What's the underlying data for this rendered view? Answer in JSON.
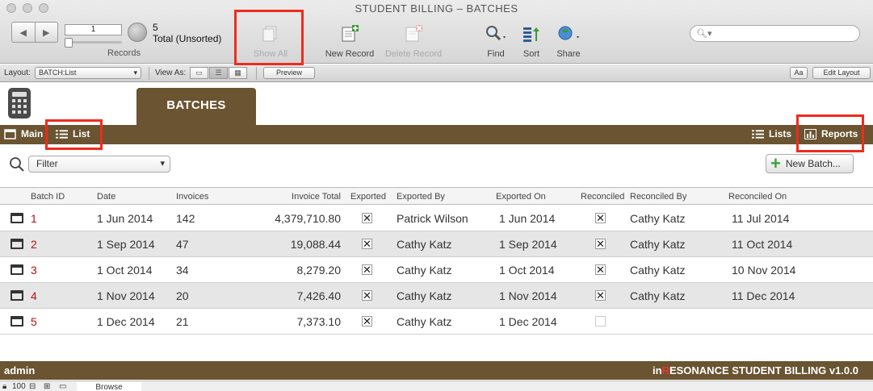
{
  "window": {
    "title": "STUDENT BILLING – BATCHES"
  },
  "toolbar": {
    "record_current": "1",
    "record_count": "5",
    "record_status": "Total (Unsorted)",
    "records_label": "Records",
    "show_all": "Show All",
    "new_record": "New Record",
    "delete_record": "Delete Record",
    "find": "Find",
    "sort": "Sort",
    "share": "Share",
    "search_placeholder": ""
  },
  "layoutbar": {
    "layout_label": "Layout:",
    "layout_value": "BATCH:List",
    "view_as_label": "View As:",
    "preview": "Preview",
    "font_btn": "Aa",
    "edit_layout": "Edit Layout"
  },
  "header": {
    "tab_title": "BATCHES",
    "nav_main": "Main",
    "nav_list": "List",
    "nav_lists": "Lists",
    "nav_reports": "Reports"
  },
  "filter": {
    "label": "Filter"
  },
  "new_batch": {
    "label": "New Batch..."
  },
  "table": {
    "columns": {
      "batch_id": "Batch ID",
      "date": "Date",
      "invoices": "Invoices",
      "invoice_total": "Invoice Total",
      "exported": "Exported",
      "exported_by": "Exported By",
      "exported_on": "Exported On",
      "reconciled": "Reconciled",
      "reconciled_by": "Reconciled By",
      "reconciled_on": "Reconciled On"
    },
    "rows": [
      {
        "id": "1",
        "date": "1 Jun 2014",
        "invoices": "142",
        "total": "4,379,710.80",
        "exported": "✕",
        "exported_by": "Patrick Wilson",
        "exported_on": "1 Jun 2014",
        "reconciled": "✕",
        "reconciled_by": "Cathy Katz",
        "reconciled_on": "11 Jul 2014"
      },
      {
        "id": "2",
        "date": "1 Sep 2014",
        "invoices": "47",
        "total": "19,088.44",
        "exported": "✕",
        "exported_by": "Cathy Katz",
        "exported_on": "1 Sep 2014",
        "reconciled": "✕",
        "reconciled_by": "Cathy Katz",
        "reconciled_on": "11 Oct 2014"
      },
      {
        "id": "3",
        "date": "1 Oct 2014",
        "invoices": "34",
        "total": "8,279.20",
        "exported": "✕",
        "exported_by": "Cathy Katz",
        "exported_on": "1 Oct 2014",
        "reconciled": "✕",
        "reconciled_by": "Cathy Katz",
        "reconciled_on": "10 Nov 2014"
      },
      {
        "id": "4",
        "date": "1 Nov 2014",
        "invoices": "20",
        "total": "7,426.40",
        "exported": "✕",
        "exported_by": "Cathy Katz",
        "exported_on": "1 Nov 2014",
        "reconciled": "✕",
        "reconciled_by": "Cathy Katz",
        "reconciled_on": "11 Dec 2014"
      },
      {
        "id": "5",
        "date": "1 Dec 2014",
        "invoices": "21",
        "total": "7,373.10",
        "exported": "✕",
        "exported_by": "Cathy Katz",
        "exported_on": "1 Dec 2014",
        "reconciled": "",
        "reconciled_by": "",
        "reconciled_on": ""
      }
    ]
  },
  "footer": {
    "user": "admin",
    "app_prefix": "in",
    "app_red": "R",
    "app_suffix": "ESONANCE STUDENT BILLING v1.0.0"
  },
  "statusbar": {
    "zoom": "100",
    "mode": "Browse"
  },
  "colors": {
    "brown": "#6a5431",
    "highlight": "#f02b1d",
    "id_red": "#b21414"
  }
}
